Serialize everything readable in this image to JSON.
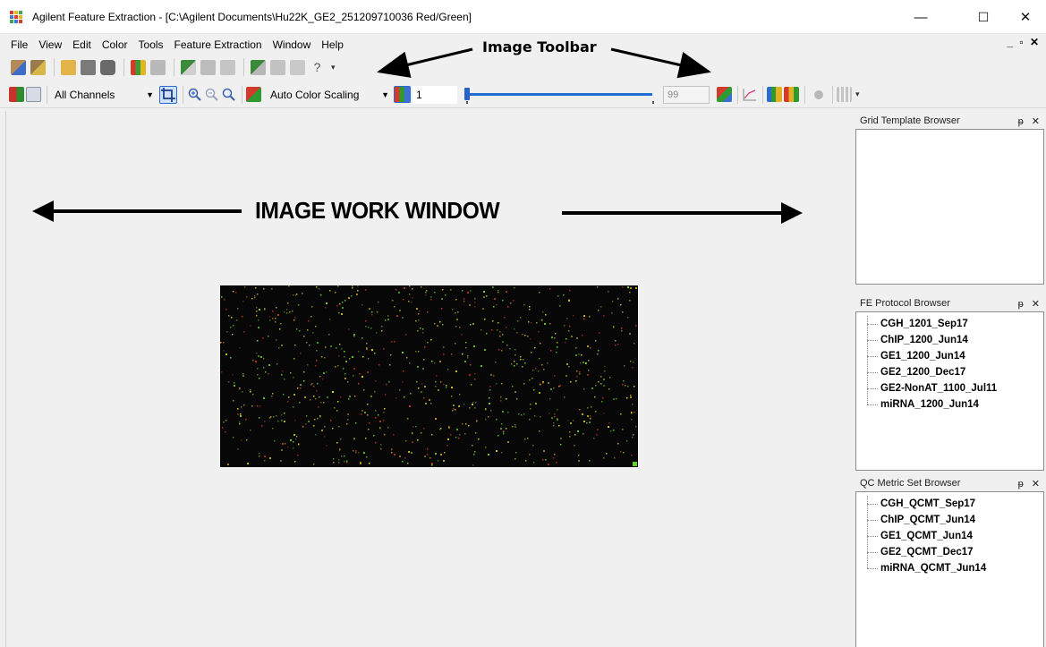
{
  "window": {
    "title": "Agilent Feature Extraction - [C:\\Agilent Documents\\Hu22K_GE2_251209710036 Red/Green]",
    "minimize_glyph": "—",
    "maximize_glyph": "☐",
    "close_glyph": "✕"
  },
  "menu": {
    "items": [
      "File",
      "View",
      "Edit",
      "Color",
      "Tools",
      "Feature Extraction",
      "Window",
      "Help"
    ],
    "mdi_controls": "_ ▫ ✕"
  },
  "toolbar": {
    "channel_select": "All Channels",
    "color_scaling_select": "Auto Color Scaling",
    "contrast_value": "1",
    "slider_position": 0.0,
    "max_value": "99"
  },
  "annotations": {
    "image_toolbar": "Image Toolbar",
    "image_work_window": "IMAGE WORK WINDOW"
  },
  "panels": {
    "grid_template": {
      "title": "Grid Template Browser",
      "items": []
    },
    "fe_protocol": {
      "title": "FE Protocol Browser",
      "items": [
        "CGH_1201_Sep17",
        "ChIP_1200_Jun14",
        "GE1_1200_Jun14",
        "GE2_1200_Dec17",
        "GE2-NonAT_1100_Jul11",
        "miRNA_1200_Jun14"
      ]
    },
    "qc_metric": {
      "title": "QC Metric Set Browser",
      "items": [
        "CGH_QCMT_Sep17",
        "ChIP_QCMT_Jun14",
        "GE1_QCMT_Jun14",
        "GE2_QCMT_Dec17",
        "miRNA_QCMT_Jun14"
      ]
    },
    "pin_close": "ᵽ ✕"
  },
  "colors": {
    "slider_blue": "#1f6fd1",
    "spot_green": "#5fd12a",
    "spot_yellow": "#e3d81e",
    "spot_red": "#c43a1e",
    "array_bg": "#070707"
  }
}
